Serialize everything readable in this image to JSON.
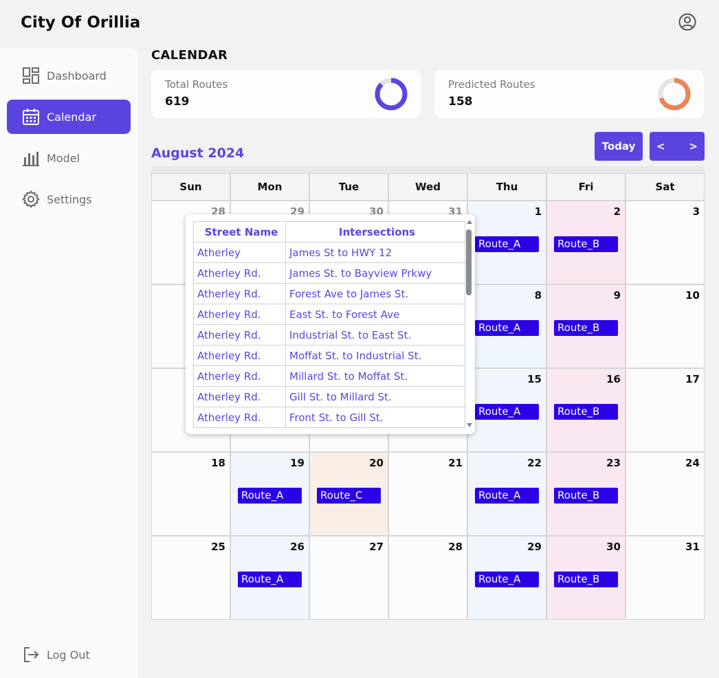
{
  "app": {
    "title": "City Of Orillia"
  },
  "sidebar": {
    "items": [
      {
        "label": "Dashboard",
        "icon": "dashboard-icon"
      },
      {
        "label": "Calendar",
        "icon": "calendar-icon",
        "active": true
      },
      {
        "label": "Model",
        "icon": "bar-chart-icon"
      },
      {
        "label": "Settings",
        "icon": "gear-icon"
      }
    ],
    "logout_label": "Log Out"
  },
  "main": {
    "section_title": "CALENDAR",
    "stats": [
      {
        "label": "Total Routes",
        "value": "619",
        "color": "#5b45e0"
      },
      {
        "label": "Predicted Routes",
        "value": "158",
        "color": "#e8865a"
      }
    ],
    "month_title": "August 2024",
    "today_label": "Today",
    "prev_label": "<",
    "next_label": ">"
  },
  "calendar": {
    "weekdays": [
      "Sun",
      "Mon",
      "Tue",
      "Wed",
      "Thu",
      "Fri",
      "Sat"
    ],
    "weeks": [
      [
        {
          "day": "28",
          "muted": true
        },
        {
          "day": "29",
          "muted": true
        },
        {
          "day": "30",
          "muted": true
        },
        {
          "day": "31",
          "muted": true
        },
        {
          "day": "1",
          "route": "Route_A"
        },
        {
          "day": "2",
          "route": "Route_B"
        },
        {
          "day": "3"
        }
      ],
      [
        {
          "day": ""
        },
        {
          "day": ""
        },
        {
          "day": ""
        },
        {
          "day": ""
        },
        {
          "day": "8",
          "route": "Route_A"
        },
        {
          "day": "9",
          "route": "Route_B"
        },
        {
          "day": "10"
        }
      ],
      [
        {
          "day": ""
        },
        {
          "day": ""
        },
        {
          "day": ""
        },
        {
          "day": ""
        },
        {
          "day": "15",
          "route": "Route_A"
        },
        {
          "day": "16",
          "route": "Route_B"
        },
        {
          "day": "17"
        }
      ],
      [
        {
          "day": "18"
        },
        {
          "day": "19",
          "route": "Route_A"
        },
        {
          "day": "20",
          "route": "Route_C"
        },
        {
          "day": "21"
        },
        {
          "day": "22",
          "route": "Route_A"
        },
        {
          "day": "23",
          "route": "Route_B"
        },
        {
          "day": "24"
        }
      ],
      [
        {
          "day": "25"
        },
        {
          "day": "26",
          "route": "Route_A"
        },
        {
          "day": "27"
        },
        {
          "day": "28"
        },
        {
          "day": "29",
          "route": "Route_A"
        },
        {
          "day": "30",
          "route": "Route_B"
        },
        {
          "day": "31"
        }
      ]
    ]
  },
  "popup": {
    "headers": [
      "Street Name",
      "Intersections"
    ],
    "rows": [
      [
        "Atherley",
        "James St to HWY 12"
      ],
      [
        "Atherley Rd.",
        "James St. to Bayview Prkwy"
      ],
      [
        "Atherley Rd.",
        "Forest Ave to James St."
      ],
      [
        "Atherley Rd.",
        "East St. to Forest Ave"
      ],
      [
        "Atherley Rd.",
        "Industrial St. to East St."
      ],
      [
        "Atherley Rd.",
        "Moffat St. to Industrial St."
      ],
      [
        "Atherley Rd.",
        "Millard St. to Moffat St."
      ],
      [
        "Atherley Rd.",
        "Gill St. to Millard St."
      ],
      [
        "Atherley Rd.",
        "Front St. to Gill St."
      ]
    ]
  }
}
